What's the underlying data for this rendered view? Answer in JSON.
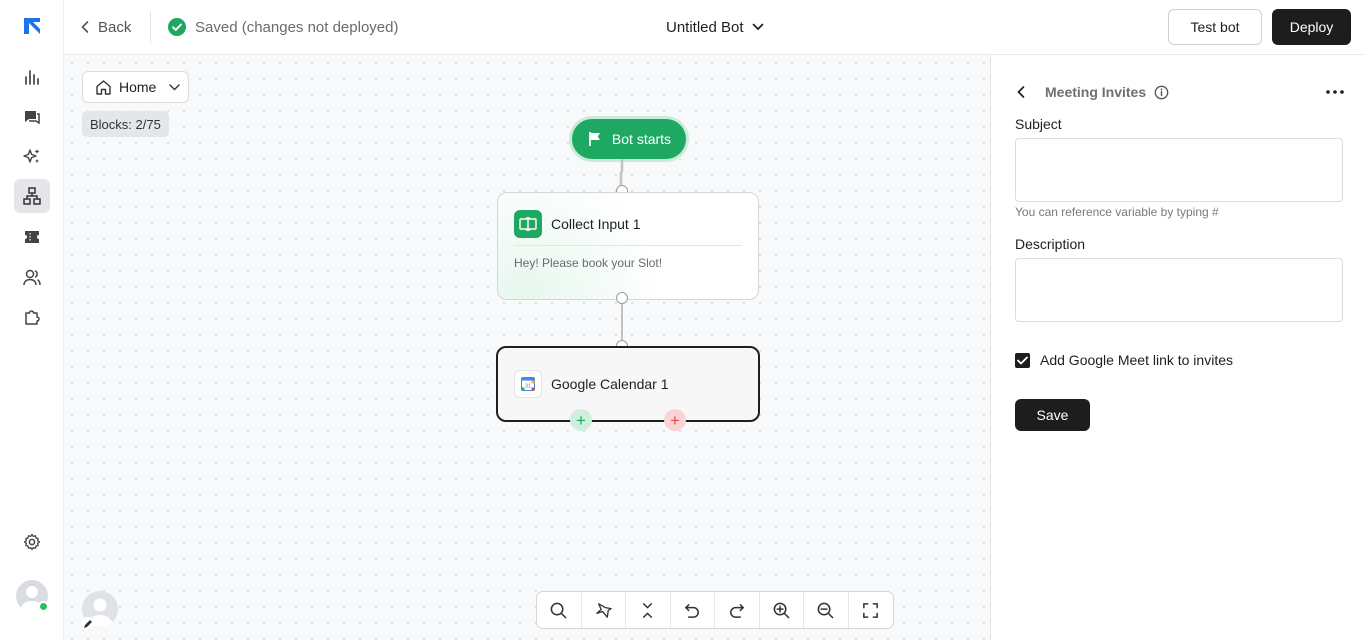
{
  "topbar": {
    "back_label": "Back",
    "save_status": "Saved (changes not deployed)",
    "bot_name": "Untitled Bot",
    "test_label": "Test bot",
    "deploy_label": "Deploy"
  },
  "canvas": {
    "flow_selector": "Home",
    "blocks_count": "Blocks: 2/75",
    "start_node": "Bot starts",
    "nodes": [
      {
        "title": "Collect Input 1",
        "message": "Hey! Please book your Slot!"
      },
      {
        "title": "Google Calendar 1"
      }
    ]
  },
  "panel": {
    "title": "Meeting Invites",
    "subject_label": "Subject",
    "subject_value": "",
    "subject_hint": "You can reference variable by typing #",
    "description_label": "Description",
    "description_value": "",
    "meet_link_label": "Add Google Meet link to invites",
    "meet_link_checked": true,
    "save_label": "Save"
  },
  "colors": {
    "accent_green": "#1fa862",
    "dark_button": "#1d1d1d",
    "brand_blue": "#1e73e8"
  }
}
